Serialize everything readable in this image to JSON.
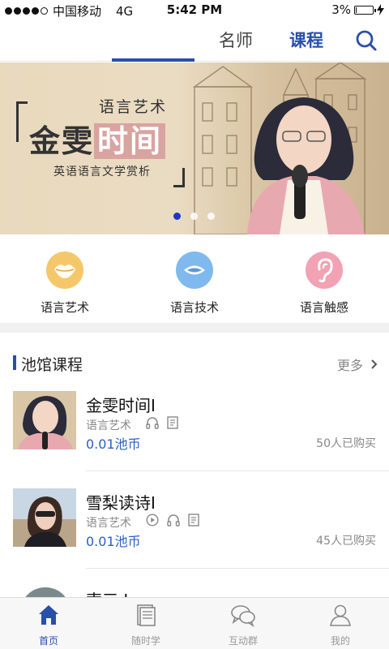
{
  "status_bar": {
    "carrier": "中国移动",
    "network": "4G",
    "time": "5:42 PM",
    "battery": "3%",
    "battery_level": 0.03
  },
  "top_tabs": {
    "tabs": [
      {
        "label": "课程",
        "active": true
      },
      {
        "label": "名师",
        "active": false
      }
    ],
    "search_icon": "search-icon"
  },
  "banner": {
    "top_text": "语言艺术",
    "title_part1": "金雯",
    "title_part2": "时间",
    "tagline": "英语语言文学赏析",
    "slide_count": 3,
    "active_slide": 1
  },
  "categories": [
    {
      "label": "语言艺术",
      "icon": "lips-icon",
      "color": "#f4c86a"
    },
    {
      "label": "语言技术",
      "icon": "mouth-icon",
      "color": "#7fb9ee"
    },
    {
      "label": "语言触感",
      "icon": "ear-icon",
      "color": "#f2a2b4"
    }
  ],
  "section": {
    "title": "池馆课程",
    "more": "更多"
  },
  "courses": [
    {
      "name": "金雯时间I",
      "category": "语言艺术",
      "icons": [
        "headphones-icon",
        "document-icon"
      ],
      "price": "0.01池币",
      "buyers": "50人已购买"
    },
    {
      "name": "雪梨读诗I",
      "category": "语言艺术",
      "icons": [
        "play-icon",
        "headphones-icon",
        "document-icon"
      ],
      "price": "0.01池币",
      "buyers": "45人已购买"
    },
    {
      "name": "索三 Ⅰ"
    }
  ],
  "bottom_nav": [
    {
      "label": "首页",
      "icon": "home-icon",
      "active": true
    },
    {
      "label": "随时学",
      "icon": "book-stack-icon",
      "active": false
    },
    {
      "label": "互动群",
      "icon": "chat-bubbles-icon",
      "active": false
    },
    {
      "label": "我的",
      "icon": "user-icon",
      "active": false
    }
  ],
  "colors": {
    "accent": "#2a4fa8",
    "price": "#2a60c0"
  }
}
